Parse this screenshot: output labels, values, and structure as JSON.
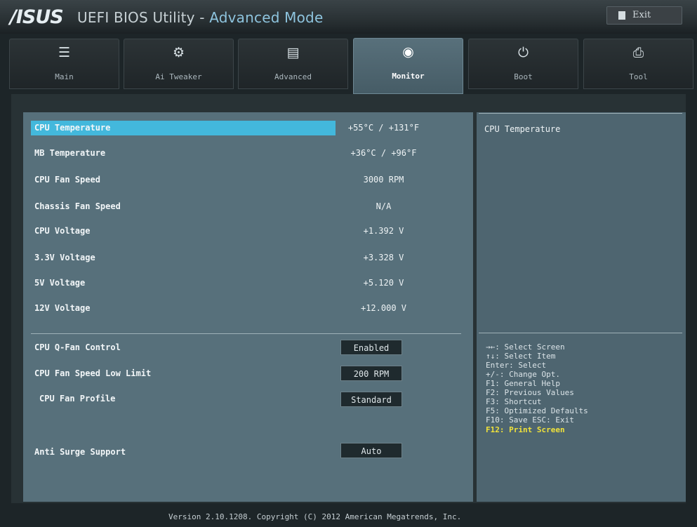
{
  "header": {
    "logo": "/ISUS",
    "title_main": "UEFI BIOS Utility - ",
    "title_accent": "Advanced Mode",
    "exit_label": "Exit"
  },
  "tabs": [
    {
      "label": "Main",
      "icon": "list-icon"
    },
    {
      "label": "Ai Tweaker",
      "icon": "tweak-icon"
    },
    {
      "label": "Advanced",
      "icon": "advanced-icon"
    },
    {
      "label": "Monitor",
      "icon": "monitor-icon",
      "active": true
    },
    {
      "label": "Boot",
      "icon": "power-icon"
    },
    {
      "label": "Tool",
      "icon": "printer-icon"
    }
  ],
  "monitor": {
    "readings": [
      {
        "label": "CPU Temperature",
        "value": "+55°C / +131°F"
      },
      {
        "label": "MB Temperature",
        "value": "+36°C / +96°F"
      },
      {
        "label": "CPU Fan Speed",
        "value": "3000 RPM"
      },
      {
        "label": "Chassis Fan Speed",
        "value": "N/A"
      },
      {
        "label": "CPU Voltage",
        "value": "+1.392 V"
      },
      {
        "label": "3.3V Voltage",
        "value": "+3.328 V"
      },
      {
        "label": "5V Voltage",
        "value": "+5.120 V"
      },
      {
        "label": "12V Voltage",
        "value": "+12.000 V"
      }
    ],
    "settings": [
      {
        "label": "CPU Q-Fan Control",
        "value": "Enabled"
      },
      {
        "label": "CPU Fan Speed Low Limit",
        "value": "200 RPM"
      },
      {
        "label": "CPU Fan Profile",
        "value": "Standard"
      },
      {
        "label": "Anti Surge Support",
        "value": "Auto"
      }
    ]
  },
  "help": {
    "title": "CPU Temperature",
    "keys": [
      "→←: Select Screen",
      "↑↓: Select Item",
      "Enter: Select",
      "+/-: Change Opt.",
      "F1: General Help",
      "F2: Previous Values",
      "F3: Shortcut",
      "F5: Optimized Defaults",
      "F10: Save  ESC: Exit",
      "F12: Print Screen"
    ]
  },
  "footer": {
    "text": "Version 2.10.1208. Copyright (C) 2012 American Megatrends, Inc."
  }
}
